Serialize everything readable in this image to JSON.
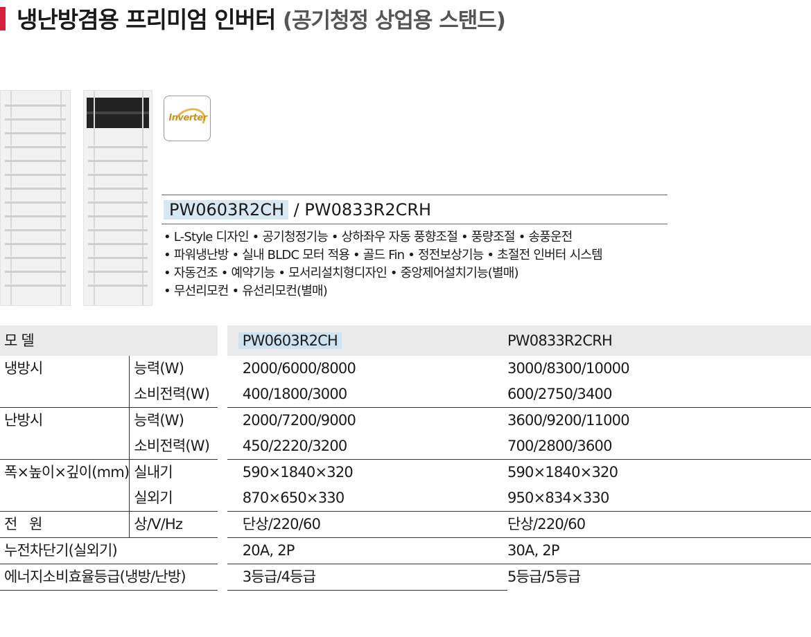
{
  "page": {
    "title_main": "냉난방겸용 프리미엄 인버터",
    "title_sub": "(공기청정 상업용 스탠드)",
    "accent_color": "#d61f3c"
  },
  "badge": {
    "text": "Inverter",
    "icon": "inverter-badge-icon"
  },
  "models_header": {
    "model1": "PW0603R2CH",
    "separator": " / ",
    "model2": "PW0833R2CRH"
  },
  "features": [
    "• L-Style 디자인 • 공기청정기능 • 상하좌우 자동 풍향조절 • 풍량조절 • 송풍운전",
    "• 파워냉난방 • 실내 BLDC 모터 적용 • 골드 Fin • 정전보상기능 • 초절전 인버터 시스템",
    "• 자동건조 • 예약기능 • 모서리설치형디자인 • 중앙제어설치기능(별매)",
    "• 무선리모컨 • 유선리모컨(별매)"
  ],
  "spec": {
    "header": {
      "label": "모 델",
      "m1": "PW0603R2CH",
      "m2": "PW0833R2CRH"
    },
    "cooling": {
      "group": "냉방시",
      "r1_label": "능력(W)",
      "r1_m1": "2000/6000/8000",
      "r1_m2": "3000/8300/10000",
      "r2_label": "소비전력(W)",
      "r2_m1": "400/1800/3000",
      "r2_m2": "600/2750/3400"
    },
    "heating": {
      "group": "난방시",
      "r1_label": "능력(W)",
      "r1_m1": "2000/7200/9000",
      "r1_m2": "3600/9200/11000",
      "r2_label": "소비전력(W)",
      "r2_m1": "450/2220/3200",
      "r2_m2": "700/2800/3600"
    },
    "size": {
      "group": "폭×높이×깊이(mm)",
      "r1_label": "실내기",
      "r1_m1": "590×1840×320",
      "r1_m2": "590×1840×320",
      "r2_label": "실외기",
      "r2_m1": "870×650×330",
      "r2_m2": "950×834×330"
    },
    "power": {
      "group": "전   원",
      "label": "상/V/Hz",
      "m1": "단상/220/60",
      "m2": "단상/220/60"
    },
    "breaker": {
      "label": "누전차단기(실외기)",
      "m1": "20A, 2P",
      "m2": "30A, 2P"
    },
    "energy": {
      "label": "에너지소비효율등급(냉방/난방)",
      "m1": "3등급/4등급",
      "m2": "5등급/5등급"
    }
  }
}
